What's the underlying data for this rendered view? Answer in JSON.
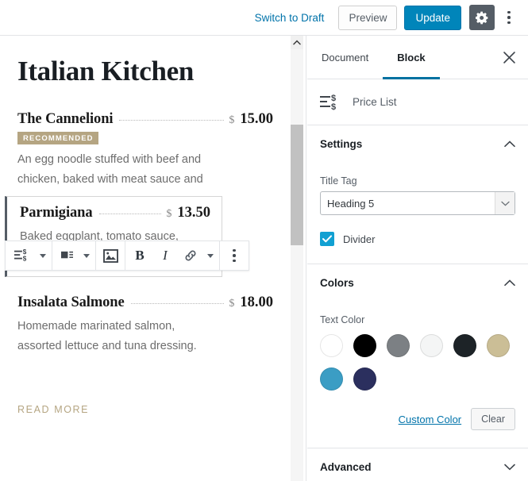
{
  "topbar": {
    "switch_to_draft": "Switch to Draft",
    "preview": "Preview",
    "update": "Update",
    "settings_icon": "gear-icon",
    "more_icon": "more-vertical-icon"
  },
  "editor": {
    "post_title": "Italian Kitchen",
    "read_more": "READ MORE",
    "items": [
      {
        "name": "The Cannelioni",
        "currency": "$",
        "price": "15.00",
        "badge": "RECOMMENDED",
        "description": "An egg noodle stuffed with beef and chicken, baked with meat sauce and",
        "selected": false
      },
      {
        "name": "Parmigiana",
        "currency": "$",
        "price": "13.50",
        "badge": "",
        "description": "Baked eggplant, tomato sauce, Mozzarella and Parmesan cheese.",
        "selected": true
      },
      {
        "name": "Insalata Salmone",
        "currency": "$",
        "price": "18.00",
        "badge": "",
        "description": "Homemade marinated salmon, assorted lettuce and tuna dressing.",
        "selected": false
      }
    ]
  },
  "block_toolbar": {
    "buttons": [
      {
        "name": "price-list-block-type-icon",
        "label": ""
      },
      {
        "name": "block-alignment-icon",
        "label": ""
      },
      {
        "name": "image-icon",
        "label": ""
      },
      {
        "name": "bold-button",
        "label": "B"
      },
      {
        "name": "italic-button",
        "label": "I"
      },
      {
        "name": "link-button",
        "label": ""
      },
      {
        "name": "more-rich-text-icon",
        "label": ""
      },
      {
        "name": "block-options-icon",
        "label": ""
      }
    ]
  },
  "sidebar": {
    "tabs": [
      {
        "label": "Document",
        "active": false
      },
      {
        "label": "Block",
        "active": true
      }
    ],
    "close_icon": "close-icon",
    "block_card": {
      "icon": "price-list-icon",
      "title": "Price List"
    },
    "settings_panel": {
      "title": "Settings",
      "expanded": true,
      "title_tag_label": "Title Tag",
      "title_tag_value": "Heading 5",
      "divider_label": "Divider",
      "divider_checked": true
    },
    "colors_panel": {
      "title": "Colors",
      "expanded": true,
      "text_color_label": "Text Color",
      "swatches": [
        {
          "name": "color-white",
          "hex": "#ffffff"
        },
        {
          "name": "color-black",
          "hex": "#000000"
        },
        {
          "name": "color-gray",
          "hex": "#7c8084"
        },
        {
          "name": "color-off-white",
          "hex": "#f4f5f5"
        },
        {
          "name": "color-charcoal",
          "hex": "#1d2327"
        },
        {
          "name": "color-tan",
          "hex": "#cbbe96"
        },
        {
          "name": "color-cyan-blue",
          "hex": "#3b9dc4"
        },
        {
          "name": "color-navy",
          "hex": "#2b2f5e"
        }
      ],
      "custom_color": "Custom Color",
      "clear": "Clear"
    },
    "advanced_panel": {
      "title": "Advanced",
      "expanded": false
    }
  },
  "theme": {
    "accent_blue": "#0085ba",
    "link_blue": "#0073aa",
    "badge_tan": "#b5a582",
    "checkbox_blue": "#11a0d2",
    "tab_underline": "#0071a1"
  }
}
